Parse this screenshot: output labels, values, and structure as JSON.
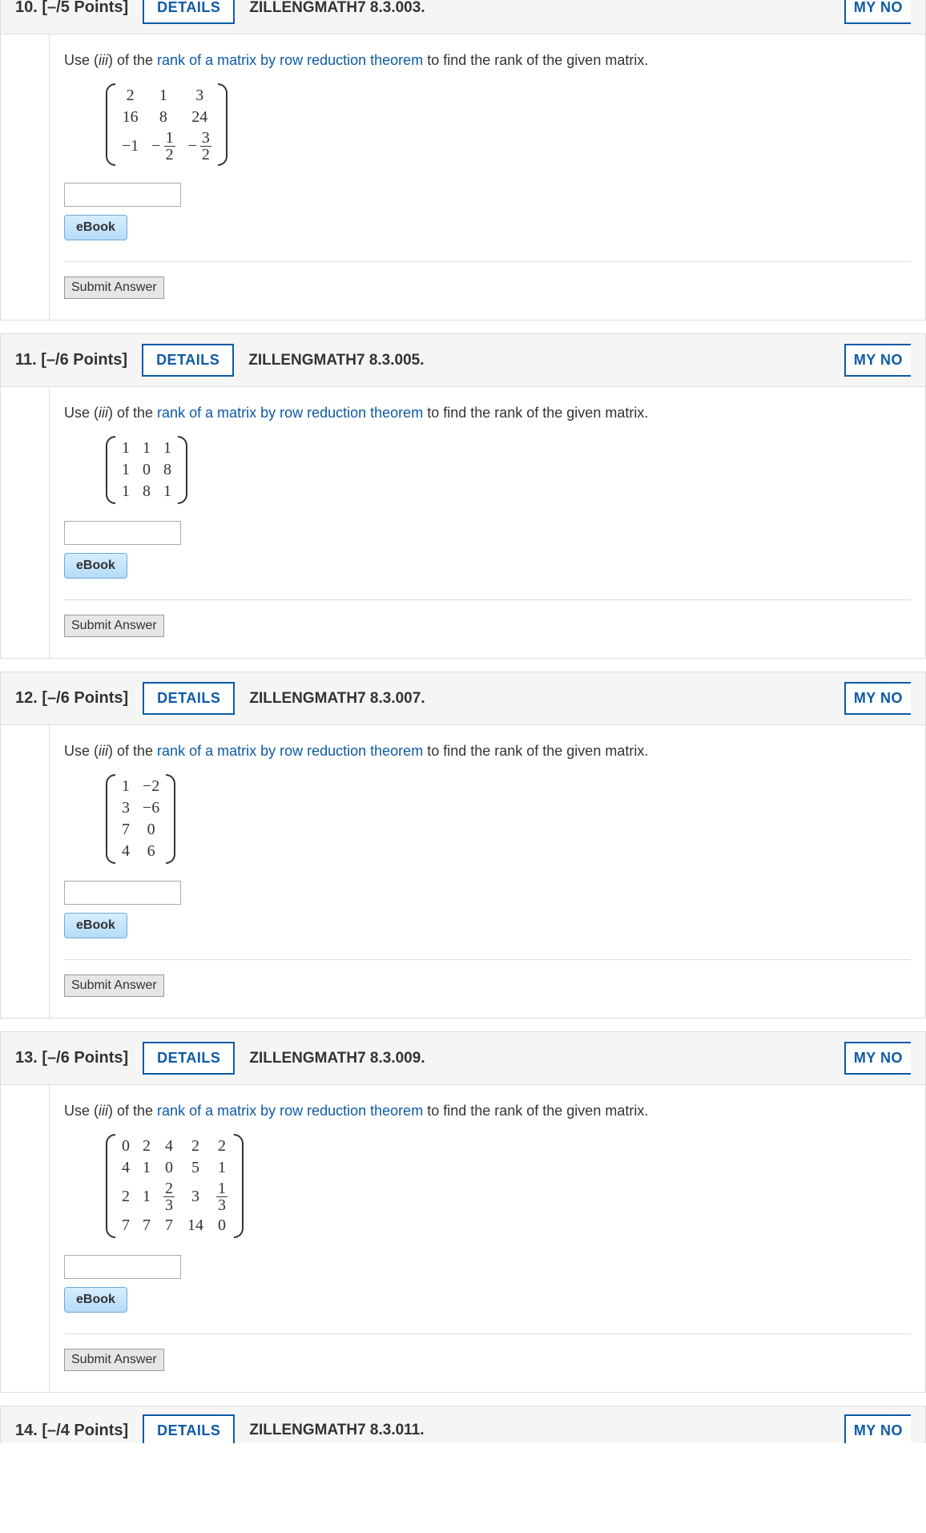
{
  "common": {
    "details_label": "DETAILS",
    "mynotes_label": "MY NO",
    "ebook_label": "eBook",
    "submit_label": "Submit Answer",
    "prompt_pre": "Use (",
    "prompt_iii": "iii",
    "prompt_mid": ") of the ",
    "theorem_text": "rank of a matrix by row reduction theorem",
    "prompt_post": " to find the rank of the given matrix."
  },
  "q10": {
    "number_label": "10.",
    "points": "[–/5 Points]",
    "source": "ZILLENGMATH7 8.3.003.",
    "matrix": {
      "cols": 3,
      "rows": [
        [
          "2",
          "1",
          "3"
        ],
        [
          "16",
          "8",
          "24"
        ],
        [
          "−1",
          {
            "neg": true,
            "frac": [
              "1",
              "2"
            ]
          },
          {
            "neg": true,
            "frac": [
              "3",
              "2"
            ]
          }
        ]
      ]
    }
  },
  "q11": {
    "number_label": "11.",
    "points": "[–/6 Points]",
    "source": "ZILLENGMATH7 8.3.005.",
    "matrix": {
      "cols": 3,
      "rows": [
        [
          "1",
          "1",
          "1"
        ],
        [
          "1",
          "0",
          "8"
        ],
        [
          "1",
          "8",
          "1"
        ]
      ]
    }
  },
  "q12": {
    "number_label": "12.",
    "points": "[–/6 Points]",
    "source": "ZILLENGMATH7 8.3.007.",
    "matrix": {
      "cols": 2,
      "rows": [
        [
          "1",
          "−2"
        ],
        [
          "3",
          "−6"
        ],
        [
          "7",
          "0"
        ],
        [
          "4",
          "6"
        ]
      ]
    }
  },
  "q13": {
    "number_label": "13.",
    "points": "[–/6 Points]",
    "source": "ZILLENGMATH7 8.3.009.",
    "matrix": {
      "cols": 5,
      "rows": [
        [
          "0",
          "2",
          "4",
          "2",
          "2"
        ],
        [
          "4",
          "1",
          "0",
          "5",
          "1"
        ],
        [
          "2",
          "1",
          {
            "frac": [
              "2",
              "3"
            ]
          },
          "3",
          {
            "frac": [
              "1",
              "3"
            ]
          }
        ],
        [
          "7",
          "7",
          "7",
          "14",
          "0"
        ]
      ]
    }
  },
  "q14": {
    "number_label": "14.",
    "points": "[–/4 Points]",
    "source": "ZILLENGMATH7 8.3.011."
  }
}
